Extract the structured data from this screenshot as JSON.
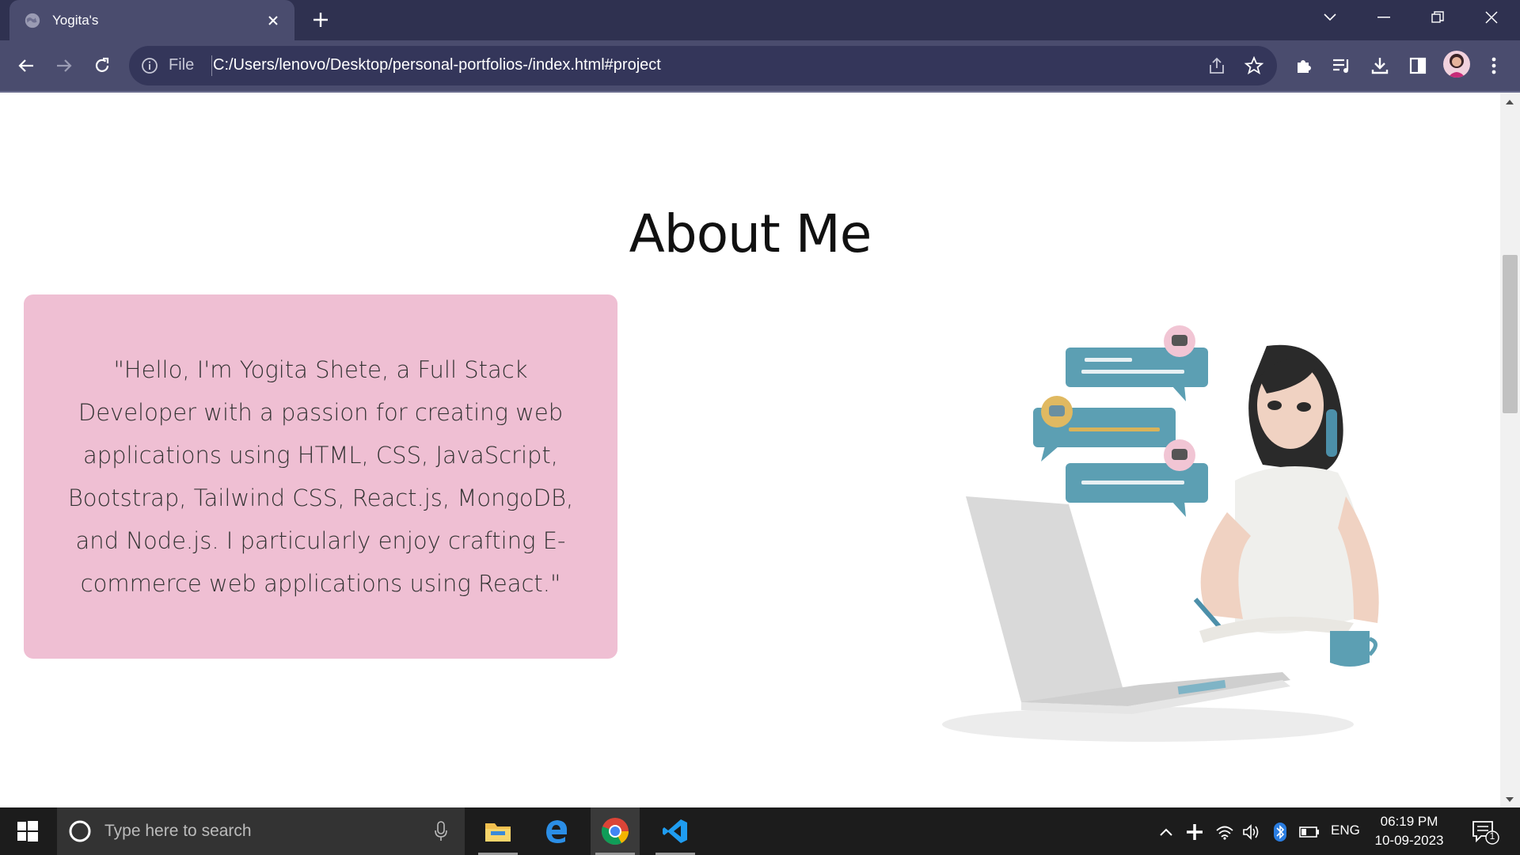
{
  "browser": {
    "tab_title": "Yogita's",
    "address_prefix": "File",
    "url": "C:/Users/lenovo/Desktop/personal-portfolios-/index.html#project"
  },
  "page": {
    "heading": "About Me",
    "about_text": "\"Hello, I'm Yogita Shete, a Full Stack Developer with a passion for creating web applications using HTML, CSS, JavaScript, Bootstrap, Tailwind CSS, React.js, MongoDB, and Node.js. I particularly enjoy crafting E-commerce web applications using React.\"",
    "card_color": "#efbfd3"
  },
  "taskbar": {
    "search_placeholder": "Type here to search",
    "language": "ENG",
    "time": "06:19 PM",
    "date": "10-09-2023",
    "notification_count": "1"
  },
  "colors": {
    "tabbar": "#2f3150",
    "toolbar": "#4a4c6e",
    "whatsapp": "#1f9d3e"
  }
}
